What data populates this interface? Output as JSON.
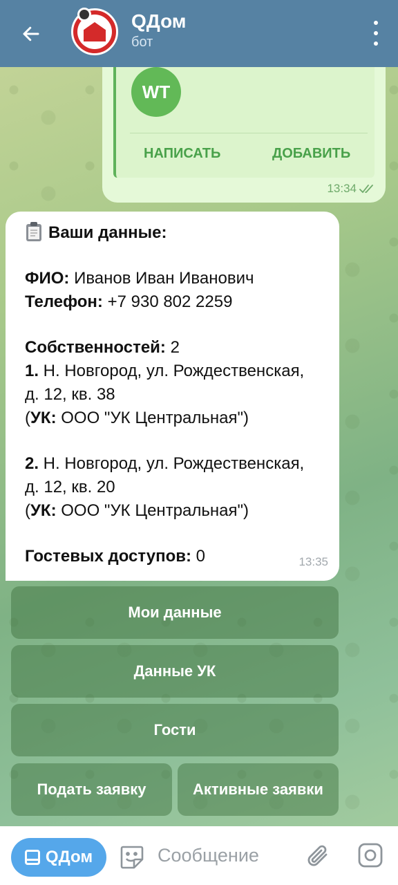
{
  "header": {
    "title": "QДом",
    "subtitle": "бот",
    "back_icon": "arrow-left-icon",
    "menu_icon": "vertical-dots-icon",
    "colors": {
      "background": "#5682a3"
    }
  },
  "contact_message": {
    "avatar_initials": "WT",
    "write_button": "НАПИСАТЬ",
    "add_button": "ДОБАВИТЬ",
    "time": "13:34"
  },
  "info_message": {
    "title": "Ваши данные:",
    "fio_label": "ФИО:",
    "fio_value": " Иванов Иван Иванович",
    "phone_label": "Телефон:",
    "phone_value": " +7  930  802  2259",
    "properties_label": "Собственностей:",
    "properties_value": " 2",
    "property1_num": "1.",
    "property1_line1": " Н. Новгород, ул. Рождественская,",
    "property1_line2": "д. 12, кв. 38",
    "property1_uk_label": "УК:",
    "property1_uk_value": " ООО \"УК Центральная\")",
    "property2_num": "2.",
    "property2_line1": " Н. Новгород, ул. Рождественская,",
    "property2_line2": "д. 12, кв. 20",
    "property2_uk_label": "УК:",
    "property2_uk_value": " ООО \"УК Центральная\")",
    "guests_label": "Гостевых доступов:",
    "guests_value": " 0",
    "time": "13:35"
  },
  "keyboard": {
    "my_data": "Мои данные",
    "uk_data": "Данные УК",
    "guests": "Гости",
    "submit_request": "Подать заявку",
    "active_requests": "Активные заявки"
  },
  "input_bar": {
    "bot_menu_label": "QДом",
    "placeholder": "Сообщение",
    "icons": [
      "sticker-icon",
      "paperclip-icon",
      "camera-icon"
    ],
    "colors": {
      "bot_menu": "#55a7ea"
    }
  }
}
